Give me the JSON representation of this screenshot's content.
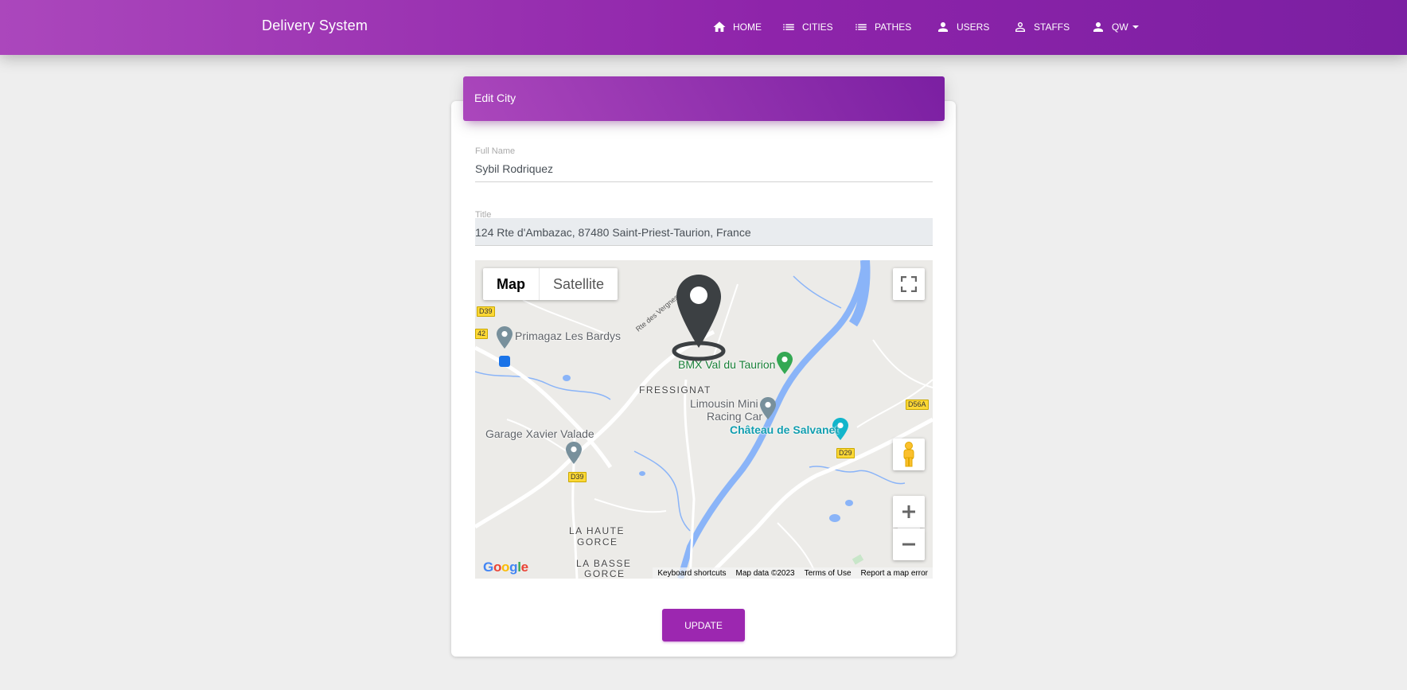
{
  "navbar": {
    "brand": "Delivery System",
    "items": [
      {
        "label": "HOME",
        "icon": "home-icon"
      },
      {
        "label": "CITIES",
        "icon": "list-icon"
      },
      {
        "label": "PATHES",
        "icon": "list-icon"
      },
      {
        "label": "USERS",
        "icon": "person-icon"
      },
      {
        "label": "STAFFS",
        "icon": "person-outline-icon"
      },
      {
        "label": "QW",
        "icon": "person-icon"
      }
    ],
    "colors": {
      "gradient_start": "#ab47bc",
      "gradient_end": "#7b1fa2"
    }
  },
  "card": {
    "title": "Edit City",
    "full_name": {
      "label": "Full Name",
      "value": "Sybil Rodriquez"
    },
    "title_field": {
      "label": "Title",
      "value": "124 Rte d'Ambazac, 87480 Saint-Priest-Taurion, France"
    },
    "update_label": "UPDATE"
  },
  "map": {
    "type_map": "Map",
    "type_satellite": "Satellite",
    "pois": {
      "primagaz": "Primagaz Les Bardys",
      "bmx": "BMX Val du Taurion",
      "limousin1": "Limousin Mini",
      "limousin2": "Racing Car",
      "chateau": "Château de Salvanet",
      "garage": "Garage Xavier Valade"
    },
    "places": {
      "fressignat": "FRESSIGNAT",
      "haute1": "LA HAUTE",
      "haute2": "GORCE",
      "basse1": "LA BASSE",
      "basse2": "GORCE"
    },
    "road_label": "Rte des Vergnes",
    "roads": {
      "d39a": "D39",
      "d42": "42",
      "d39b": "D39",
      "d56a": "D56A",
      "d29": "D29"
    },
    "google": "Google",
    "footer": {
      "shortcuts": "Keyboard shortcuts",
      "data": "Map data ©2023",
      "terms": "Terms of Use",
      "report": "Report a map error"
    }
  }
}
